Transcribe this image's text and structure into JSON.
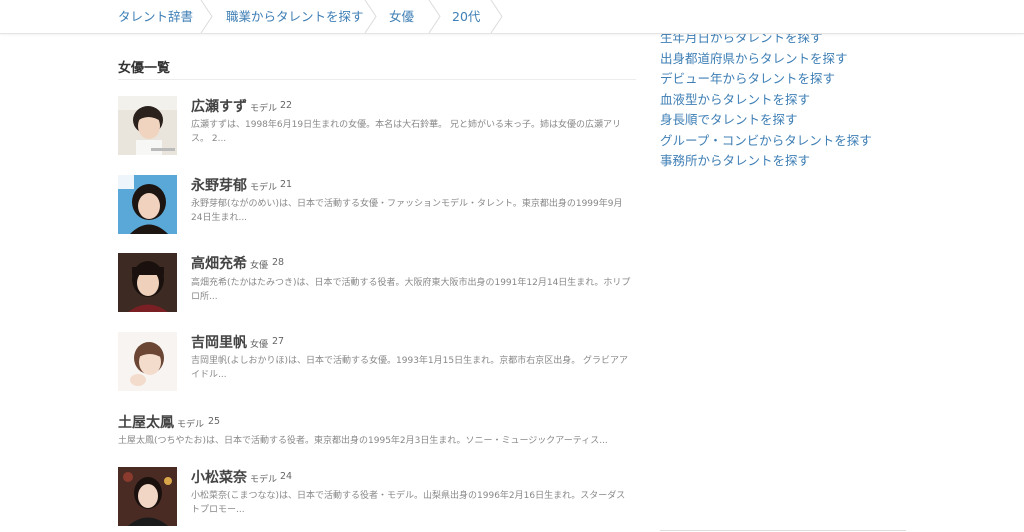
{
  "breadcrumb": [
    "タレント辞書",
    "職業からタレントを探す",
    "女優",
    "20代"
  ],
  "main": {
    "section_title": "女優一覧",
    "talents": [
      {
        "name": "広瀬すず",
        "profession": "モデル",
        "age": "22",
        "desc": "広瀬すずは、1998年6月19日生まれの女優。本名は大石鈴華。 兄と姉がいる末っ子。姉は女優の広瀬アリス。 2..."
      },
      {
        "name": "永野芽郁",
        "profession": "モデル",
        "age": "21",
        "desc": "永野芽郁(ながのめい)は、日本で活動する女優・ファッションモデル・タレント。東京都出身の1999年9月24日生まれ..."
      },
      {
        "name": "高畑充希",
        "profession": "女優",
        "age": "28",
        "desc": "高畑充希(たかはたみつき)は、日本で活動する役者。大阪府東大阪市出身の1991年12月14日生まれ。ホリプロ所..."
      },
      {
        "name": "吉岡里帆",
        "profession": "女優",
        "age": "27",
        "desc": "吉岡里帆(よしおかりほ)は、日本で活動する女優。1993年1月15日生まれ。京都市右京区出身。 グラビアアイドル..."
      },
      {
        "name": "土屋太鳳",
        "profession": "モデル",
        "age": "25",
        "desc": "土屋太鳳(つちやたお)は、日本で活動する役者。東京都出身の1995年2月3日生まれ。ソニー・ミュージックアーティス..."
      },
      {
        "name": "小松菜奈",
        "profession": "モデル",
        "age": "24",
        "desc": "小松菜奈(こまつなな)は、日本で活動する役者・モデル。山梨県出身の1996年2月16日生まれ。スターダストプロモー..."
      }
    ]
  },
  "sidebar": {
    "links": [
      "生年月日からタレントを探す",
      "出身都道府県からタレントを探す",
      "デビュー年からタレントを探す",
      "血液型からタレントを探す",
      "身長順でタレントを探す",
      "グループ・コンビからタレントを探す",
      "事務所からタレントを探す"
    ]
  },
  "colors": {
    "link": "#3f7fb5",
    "text": "#333333",
    "muted": "#888888"
  }
}
